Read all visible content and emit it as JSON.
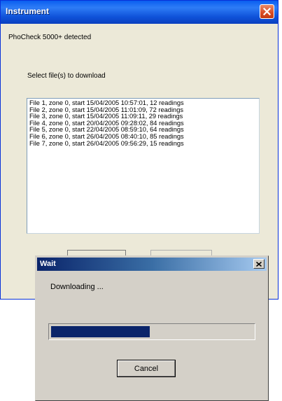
{
  "instrument": {
    "title": "Instrument",
    "detected": "PhoCheck 5000+ detected",
    "select_label": "Select file(s) to download",
    "files": [
      "File 1, zone 0, start 15/04/2005 10:57:01, 12 readings",
      "File 2, zone 0, start 15/04/2005 11:01:09, 72 readings",
      "File 3, zone 0, start 15/04/2005 11:09:11, 29 readings",
      "File 4, zone 0, start 20/04/2005 09:28:02, 84 readings",
      "File 5, zone 0, start 22/04/2005 08:59:10, 64 readings",
      "File 6, zone 0, start 26/04/2005 08:40:10, 85 readings",
      "File 7, zone 0, start 26/04/2005 09:56:29, 15 readings"
    ],
    "close_icon": "close-icon",
    "close_color": "#d94b24"
  },
  "wait": {
    "title": "Wait",
    "message": "Downloading ...",
    "progress_fraction": 0.49,
    "cancel_label": "Cancel",
    "close_icon": "close-icon"
  },
  "colors": {
    "xp_title": "#0a5ff0",
    "classic_title": "#0a246a",
    "progress": "#0a246a"
  }
}
